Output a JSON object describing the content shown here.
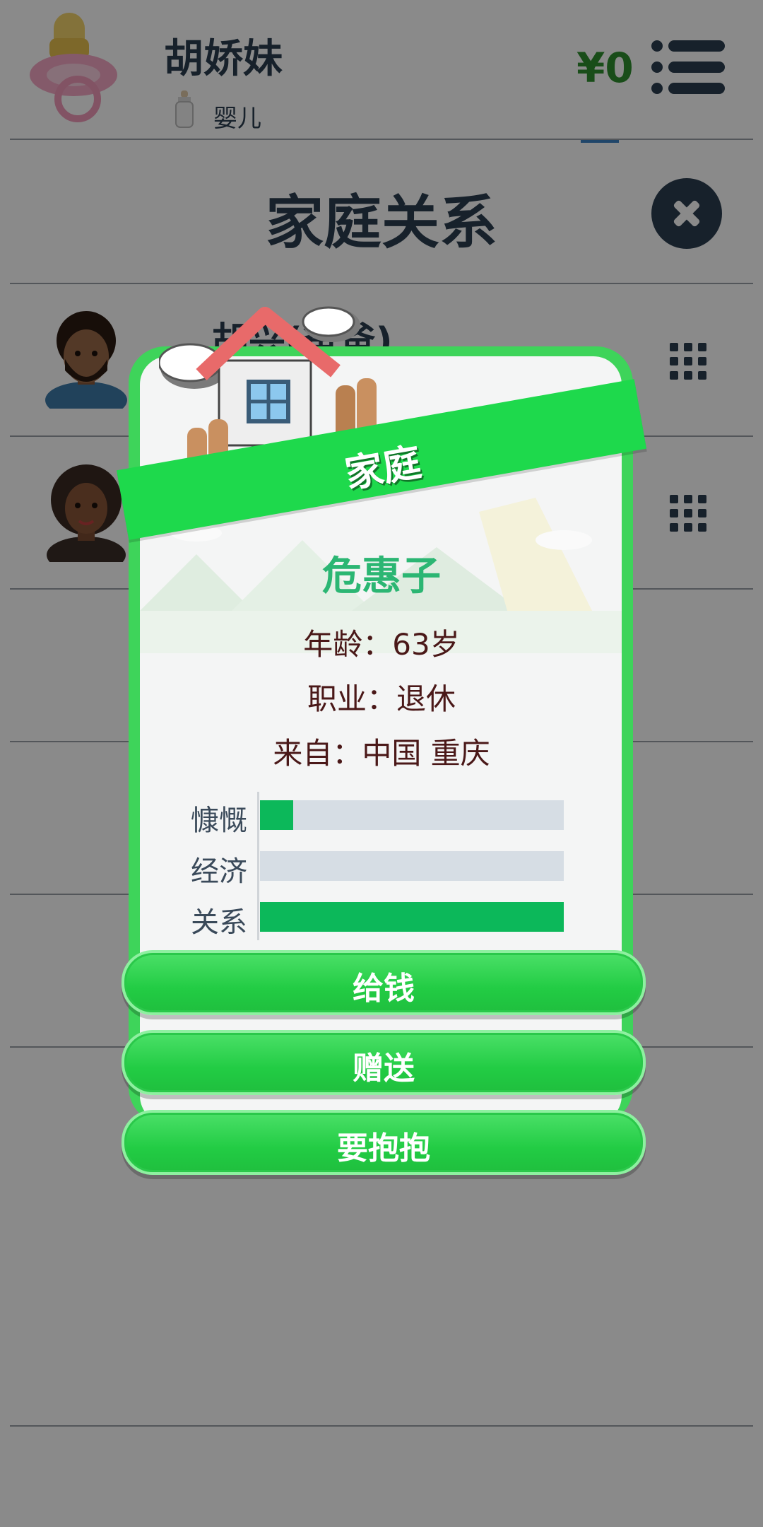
{
  "header": {
    "player_name": "胡娇妹",
    "life_stage": "婴儿",
    "money": "¥0"
  },
  "screen": {
    "title": "家庭关系",
    "relatives": [
      {
        "name": "胡兴(爸爸)"
      },
      {
        "name": ""
      }
    ]
  },
  "modal": {
    "banner": "家庭",
    "name": "危惠子",
    "age": "年龄：63岁",
    "job": "职业：退休",
    "origin": "来自：中国 重庆",
    "stats": [
      {
        "label": "慷慨",
        "level": 0.11
      },
      {
        "label": "经济",
        "level": 0.0
      },
      {
        "label": "关系",
        "level": 1.0
      }
    ],
    "buttons": {
      "give_money": "给钱",
      "gift": "赠送",
      "hug": "要抱抱"
    }
  },
  "colors": {
    "accent_green": "#1ed94c",
    "stat_fill": "#0cb85a",
    "money_green": "#2f8f2f",
    "name_green": "#2bb673",
    "dark_navy": "#2c3e50"
  }
}
